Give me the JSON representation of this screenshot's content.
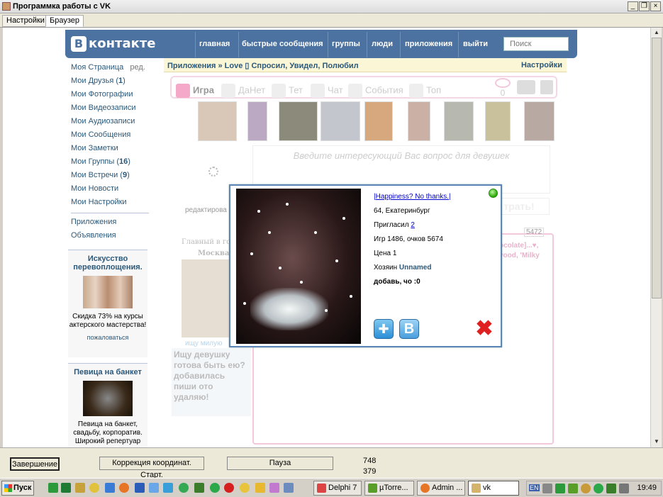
{
  "window": {
    "title": "Программка работы с VK"
  },
  "menu": {
    "tabs": [
      "Настройки",
      "Браузер"
    ]
  },
  "vk": {
    "logo": "контакте",
    "logo_letter": "B",
    "nav": [
      "главная",
      "быстрые сообщения",
      "группы",
      "люди",
      "приложения",
      "выйти"
    ],
    "search_placeholder": "Поиск",
    "left_links": [
      {
        "label": "Моя Страница",
        "extra": "ред."
      },
      {
        "label": "Мои Друзья",
        "count": "1"
      },
      {
        "label": "Мои Фотографии"
      },
      {
        "label": "Мои Видеозаписи"
      },
      {
        "label": "Мои Аудиозаписи"
      },
      {
        "label": "Мои Сообщения"
      },
      {
        "label": "Мои Заметки"
      },
      {
        "label": "Мои Группы",
        "count": "16"
      },
      {
        "label": "Мои Встречи",
        "count": "9"
      },
      {
        "label": "Мои Новости"
      },
      {
        "label": "Мои Настройки"
      }
    ],
    "left_links2": [
      "Приложения",
      "Объявления"
    ],
    "ad1": {
      "title": "Искусство перевоплощения.",
      "text": "Скидка 73% на курсы актерского мастерства!",
      "complain": "пожаловаться"
    },
    "ad2": {
      "title": "Певица на банкет",
      "text": "Певица на банкет, свадьбу, корпоратив. Широкий репертуар"
    },
    "app": {
      "breadcrumb_link": "Приложения",
      "breadcrumb_rest": " » Love ▯ Спросил, Увидел, Полюбил",
      "settings": "Настройки",
      "tabs": [
        "Игра",
        "ДаНет",
        "Тет",
        "Чат",
        "События",
        "Топ"
      ],
      "views": "0",
      "ask_placeholder": "Введите интересующий Вас вопрос для девушек",
      "play": "трать!",
      "edited": "редактирова",
      "main_left": "Главный в гор",
      "city": "Москва",
      "counter": "5472",
      "side_text1": "ocolate]...♥,",
      "side_text2": "vood, 'Milky",
      "seek_name": "ищу милую",
      "seek_text": "Ищу девушку готова быть ею? добавилась пиши ото удаляю!"
    },
    "modal": {
      "name": "|Happiness? No thanks.|",
      "age_city": "64, Екатеринбург",
      "invited_label": "Пригласил ",
      "invited_count": "2",
      "stats": "Игр 1486, очков 5674",
      "price": "Цена 1",
      "owner_label": "Хозяин ",
      "owner": "Unnamed",
      "note": "добавь, чо :0",
      "vk_label": "B"
    }
  },
  "controls": {
    "finish": "Завершение",
    "correction": "Коррекция координат. Старт.",
    "pause": "Пауза",
    "x": "748",
    "y": "379"
  },
  "taskbar": {
    "start": "Пуск",
    "tasks": [
      "Delphi 7",
      "µTorre...",
      "Admin ...",
      "vk"
    ],
    "lang": "EN",
    "clock": "19:49"
  }
}
